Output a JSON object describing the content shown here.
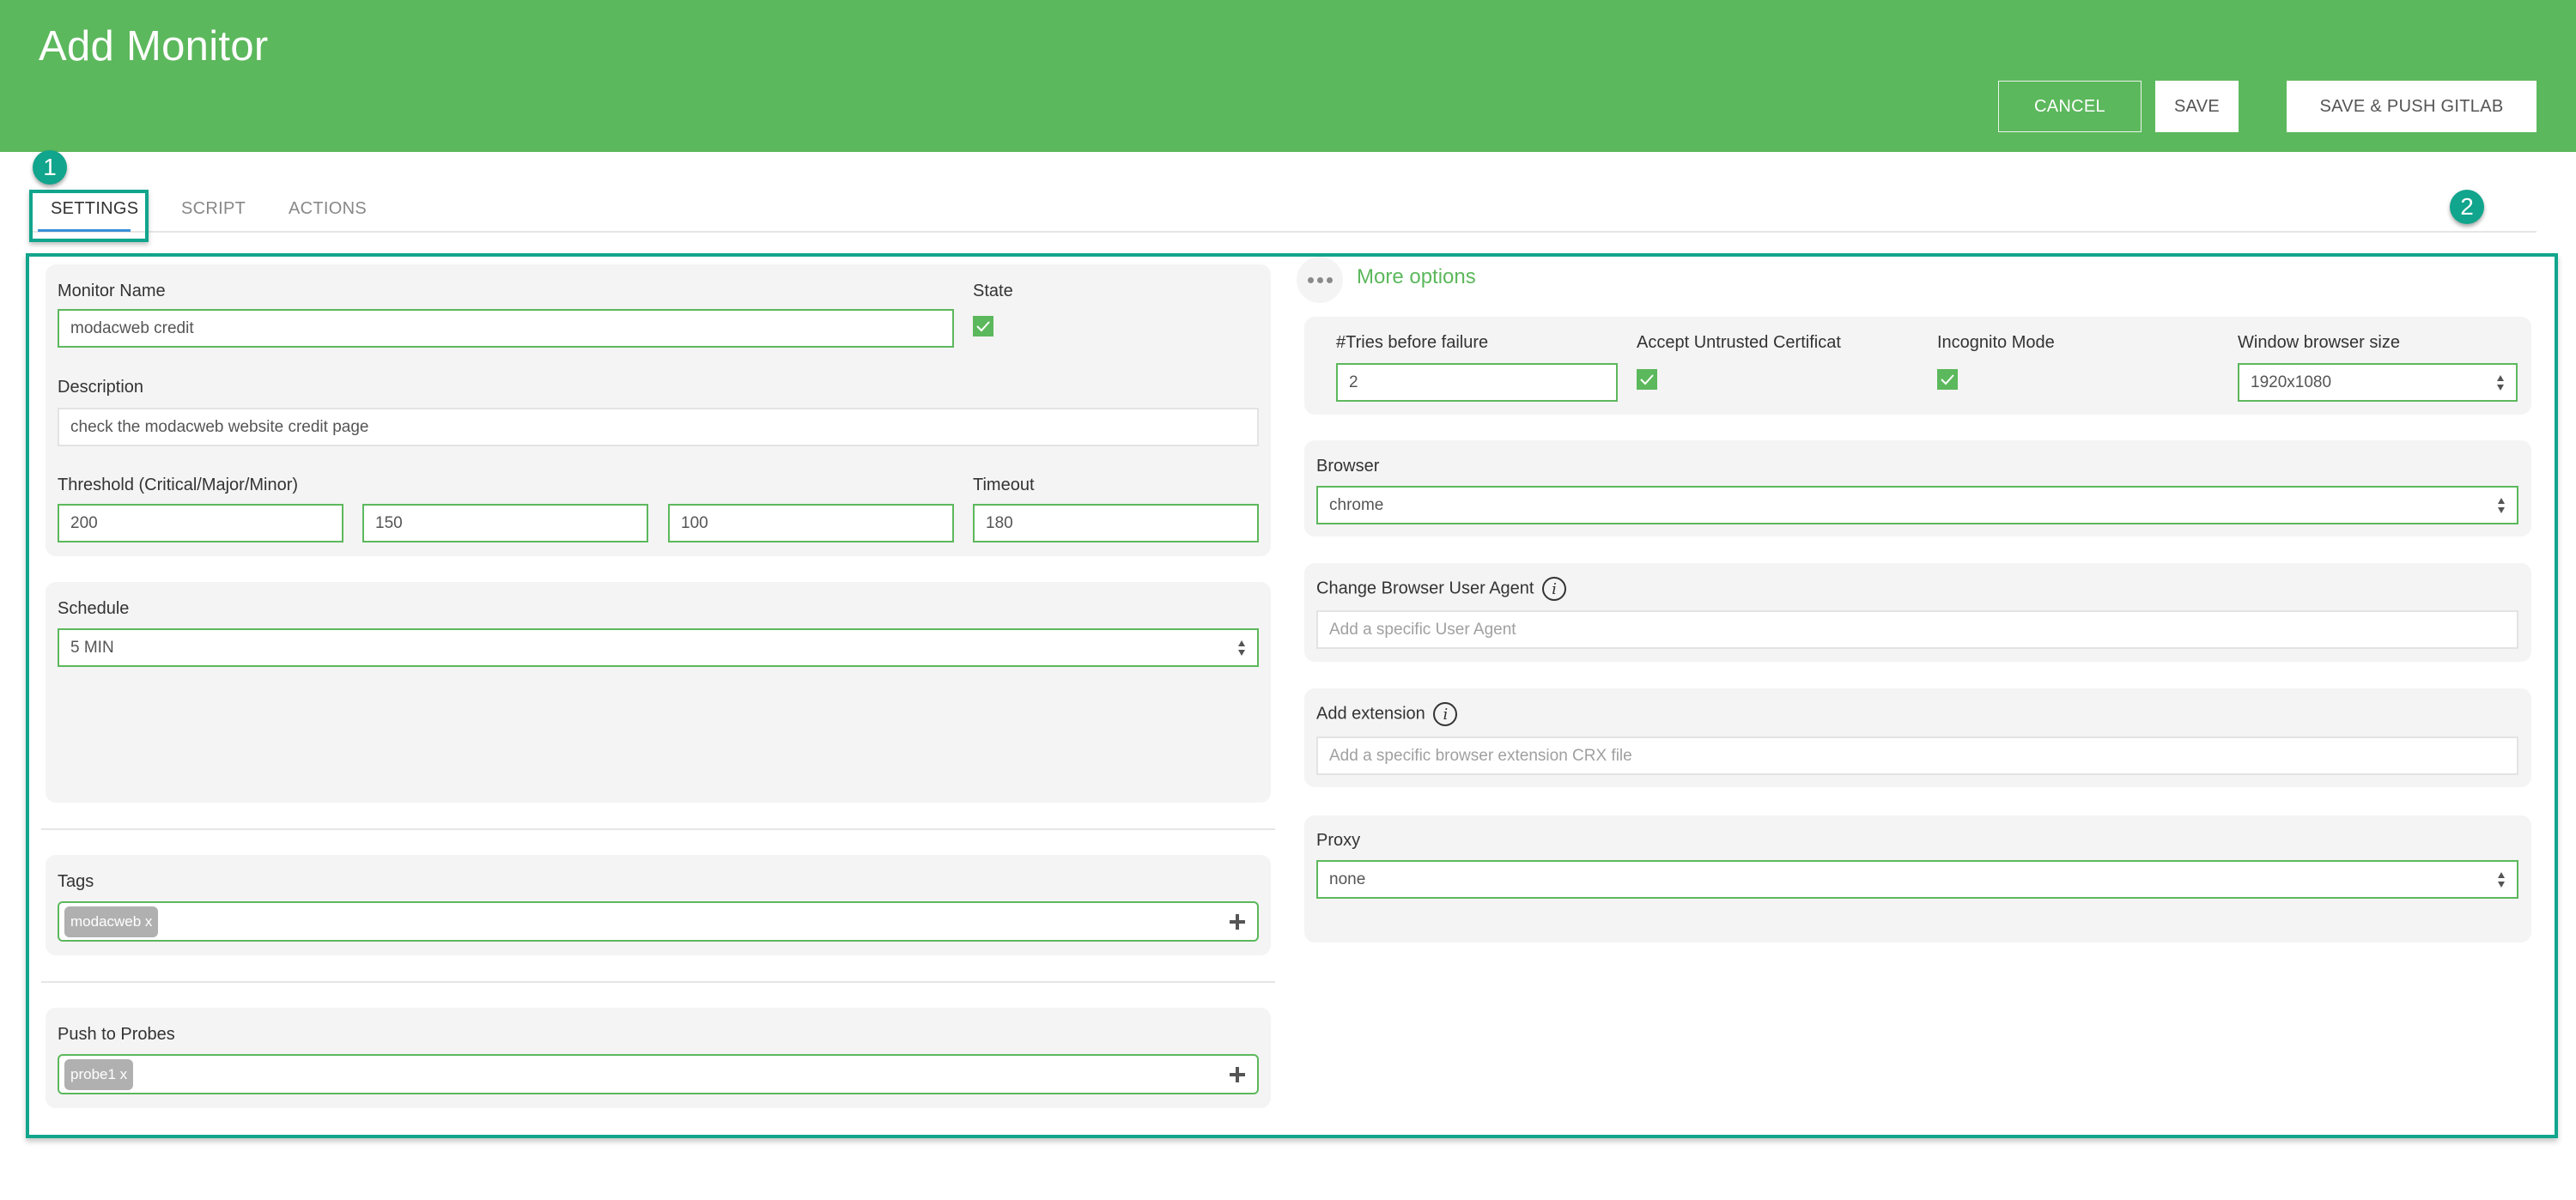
{
  "header": {
    "title": "Add Monitor",
    "buttons": {
      "cancel": "CANCEL",
      "save": "SAVE",
      "save_push": "SAVE & PUSH GITLAB"
    }
  },
  "tabs": [
    {
      "label": "SETTINGS",
      "active": true
    },
    {
      "label": "SCRIPT",
      "active": false
    },
    {
      "label": "ACTIONS",
      "active": false
    }
  ],
  "annotations": {
    "badge1": "1",
    "badge2": "2"
  },
  "settings": {
    "monitor_name": {
      "label": "Monitor Name",
      "value": "modacweb credit"
    },
    "state": {
      "label": "State",
      "checked": true
    },
    "description": {
      "label": "Description",
      "value": "check the modacweb website credit page"
    },
    "threshold": {
      "label": "Threshold (Critical/Major/Minor)",
      "critical": "200",
      "major": "150",
      "minor": "100"
    },
    "timeout": {
      "label": "Timeout",
      "value": "180"
    },
    "schedule": {
      "label": "Schedule",
      "value": "5 MIN"
    },
    "tags": {
      "label": "Tags",
      "items": [
        "modacweb x"
      ]
    },
    "probes": {
      "label": "Push to Probes",
      "items": [
        "probe1 x"
      ]
    }
  },
  "more_options": {
    "label": "More options",
    "tries": {
      "label": "#Tries before failure",
      "value": "2"
    },
    "accept_cert": {
      "label": "Accept Untrusted Certificat",
      "checked": true
    },
    "incognito": {
      "label": "Incognito Mode",
      "checked": true
    },
    "window_size": {
      "label": "Window browser size",
      "value": "1920x1080"
    },
    "browser": {
      "label": "Browser",
      "value": "chrome"
    },
    "user_agent": {
      "label": "Change Browser User Agent",
      "placeholder": "Add a specific User Agent"
    },
    "extension": {
      "label": "Add extension",
      "placeholder": "Add a specific browser extension CRX file"
    },
    "proxy": {
      "label": "Proxy",
      "value": "none"
    }
  },
  "colors": {
    "brand_green": "#5cb85c",
    "annotation_teal": "#10a58c",
    "active_tab_underline": "#3a8fd8"
  }
}
